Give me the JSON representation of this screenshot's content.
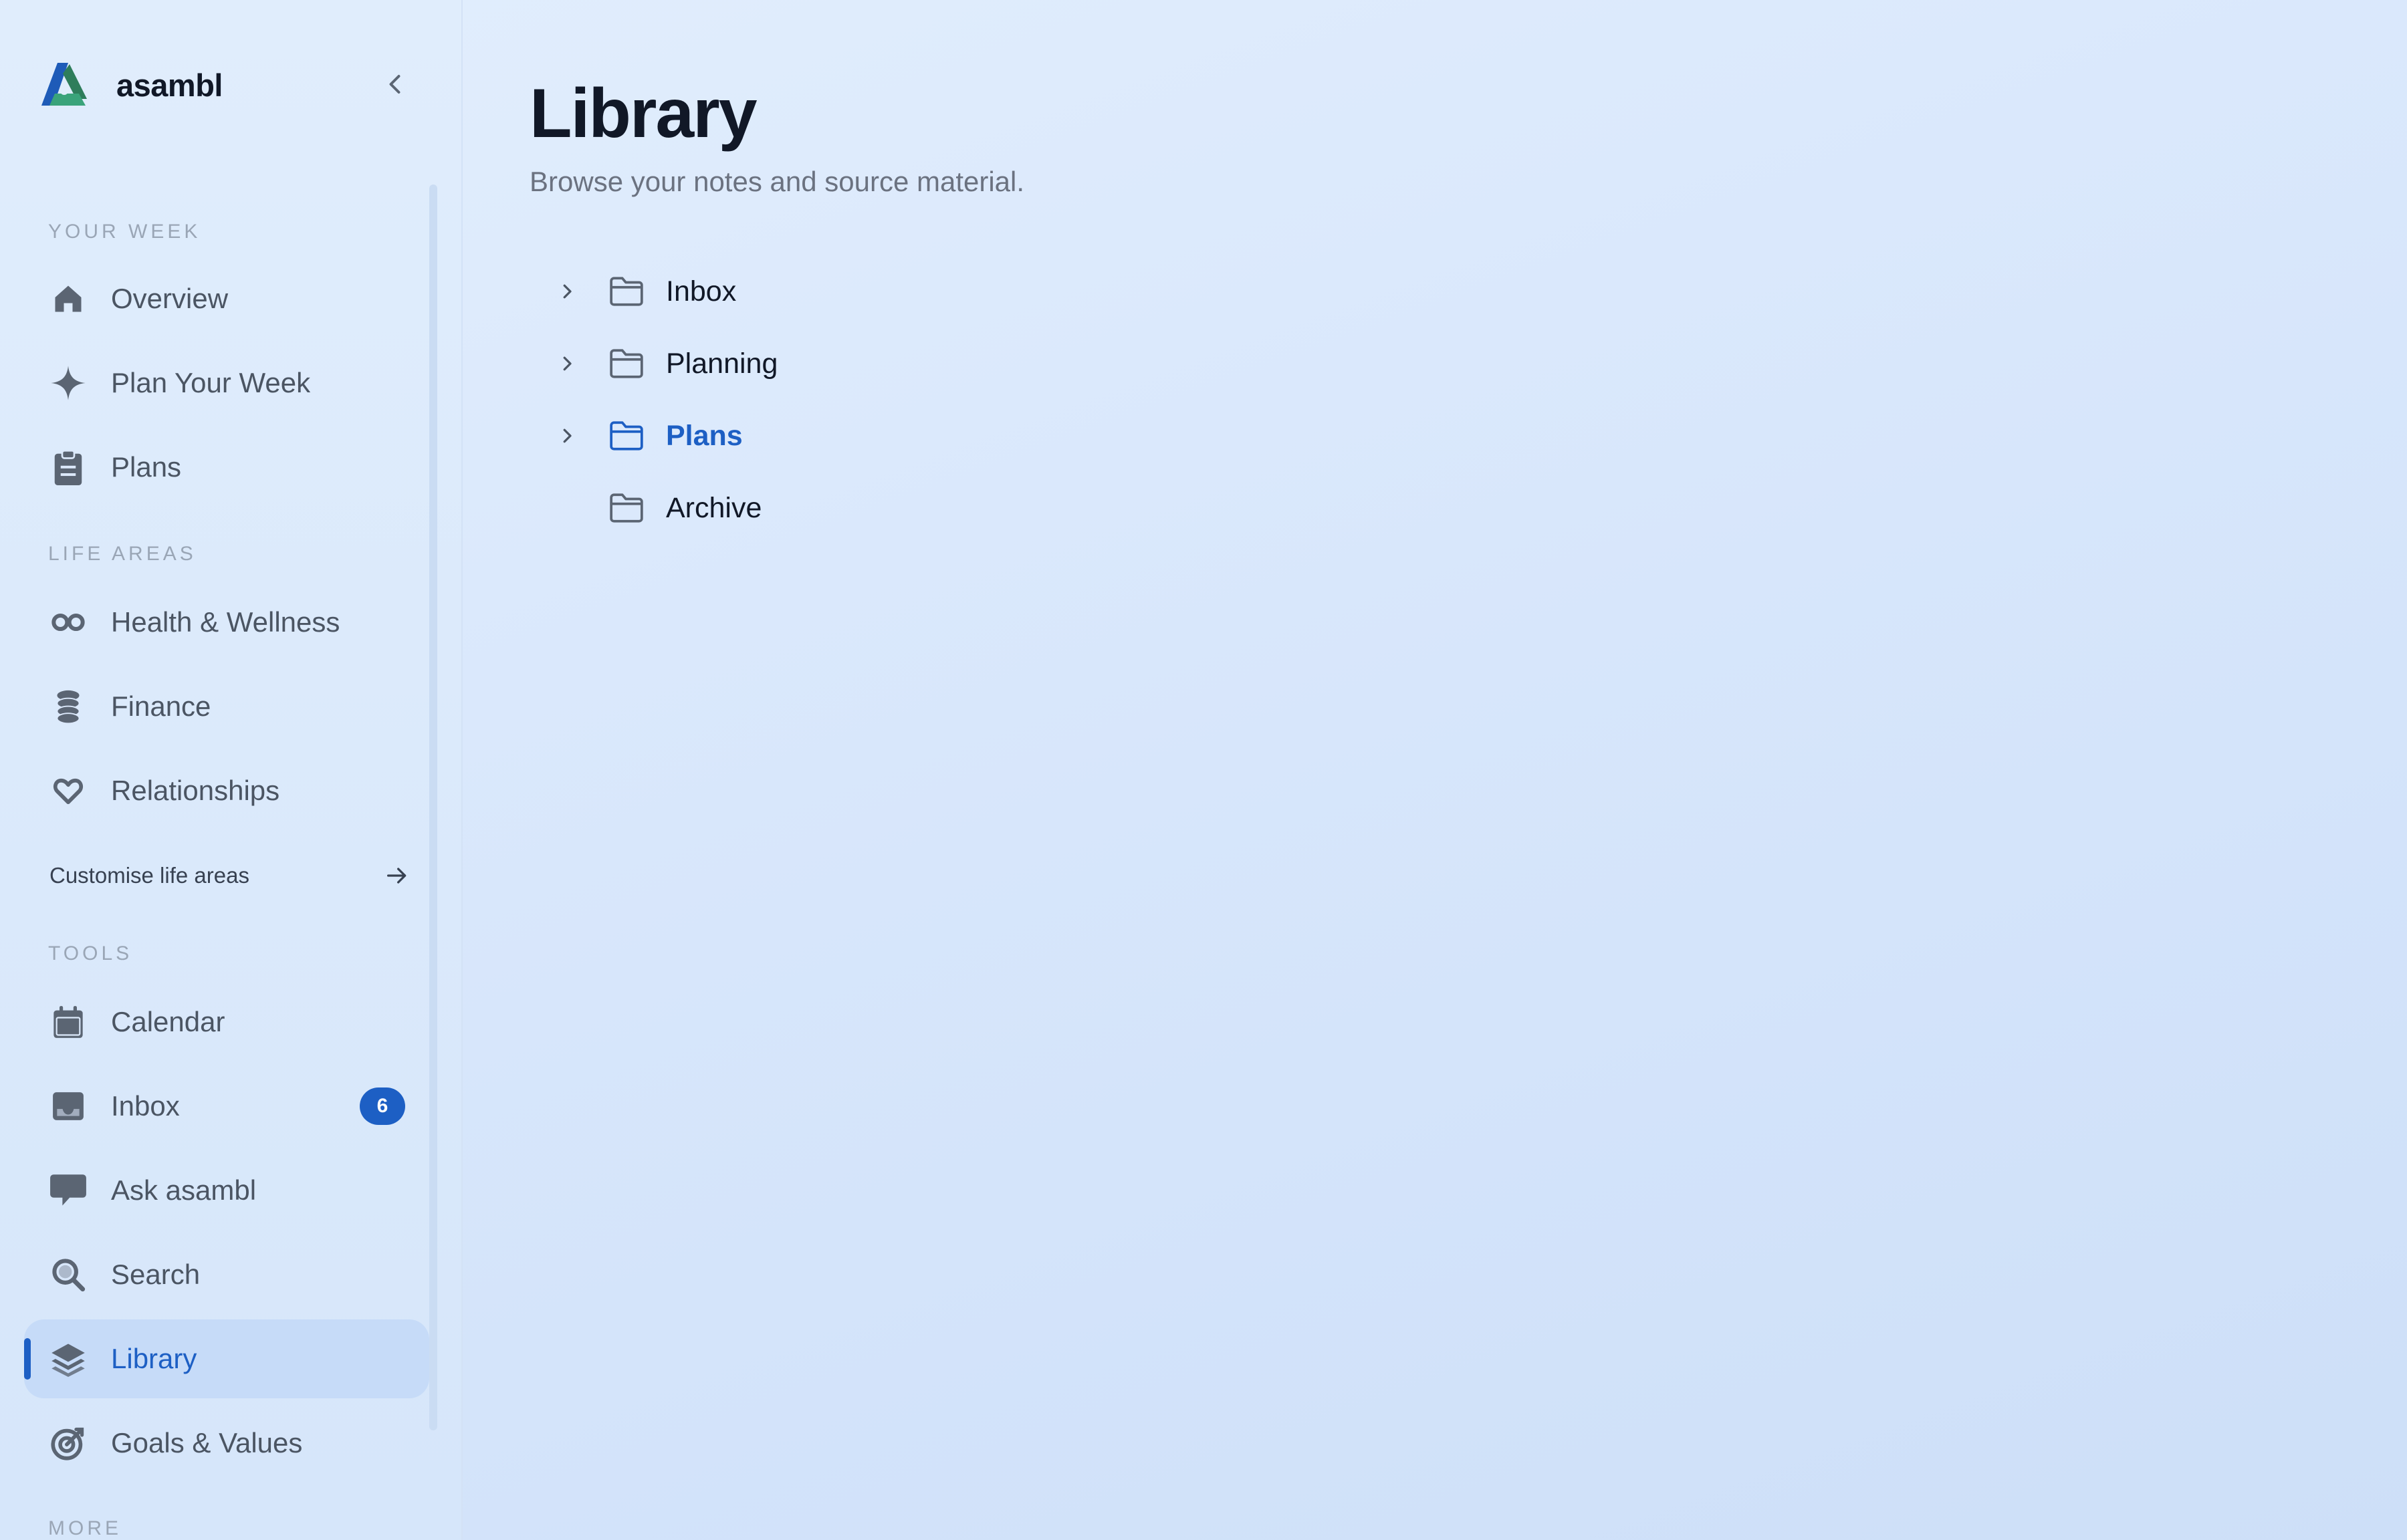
{
  "app": {
    "name": "asambl"
  },
  "sidebar": {
    "sections": [
      {
        "title": "YOUR WEEK"
      },
      {
        "title": "LIFE AREAS"
      },
      {
        "title": "TOOLS"
      },
      {
        "title": "MORE"
      }
    ],
    "items": [
      {
        "label": "Overview",
        "icon": "home-icon"
      },
      {
        "label": "Plan Your Week",
        "icon": "sparkle-icon"
      },
      {
        "label": "Plans",
        "icon": "clipboard-icon"
      },
      {
        "label": "Health & Wellness",
        "icon": "infinity-icon"
      },
      {
        "label": "Finance",
        "icon": "coins-icon"
      },
      {
        "label": "Relationships",
        "icon": "heart-icon"
      },
      {
        "label": "Calendar",
        "icon": "calendar-icon"
      },
      {
        "label": "Inbox",
        "icon": "inbox-icon",
        "badge": "6"
      },
      {
        "label": "Ask asambl",
        "icon": "chat-icon"
      },
      {
        "label": "Search",
        "icon": "search-icon"
      },
      {
        "label": "Library",
        "icon": "layers-icon",
        "active": true
      },
      {
        "label": "Goals & Values",
        "icon": "target-icon"
      }
    ],
    "customise": {
      "label": "Customise life areas",
      "icon": "arrow-right-icon"
    }
  },
  "main": {
    "title": "Library",
    "subtitle": "Browse your notes and source material.",
    "folders": [
      {
        "label": "Inbox",
        "expandable": true,
        "selected": false
      },
      {
        "label": "Planning",
        "expandable": true,
        "selected": false
      },
      {
        "label": "Plans",
        "expandable": true,
        "selected": true
      },
      {
        "label": "Archive",
        "expandable": false,
        "selected": false
      }
    ]
  },
  "colors": {
    "accent": "#1d5fc4",
    "icon": "#5b6573",
    "section_title": "#9aa6b6"
  }
}
